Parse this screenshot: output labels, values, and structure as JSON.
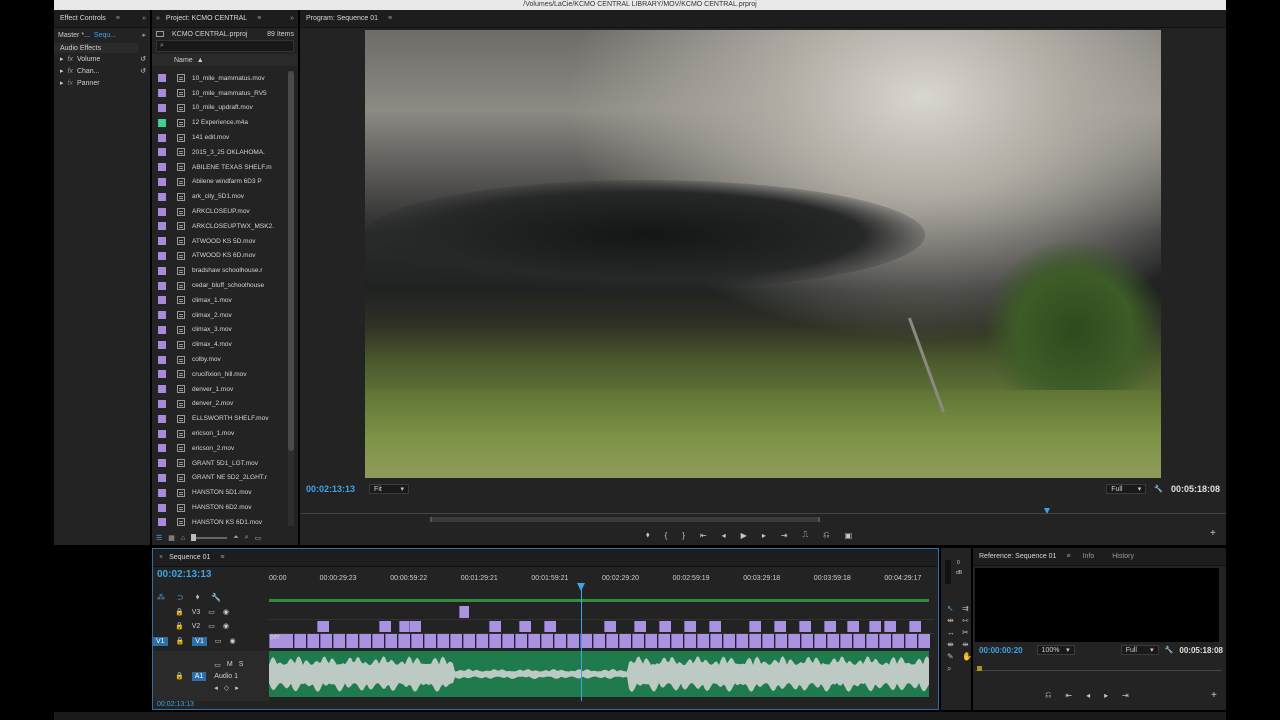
{
  "window": {
    "title": "/Volumes/LaCie/KCMO CENTRAL LIBRARY/MOV/KCMO CENTRAL.prproj"
  },
  "effect_controls": {
    "tab": "Effect Controls",
    "source": "Master *...",
    "sequence": "Sequ...",
    "section": "Audio Effects",
    "items": [
      "Volume",
      "Chan...",
      "Panner"
    ]
  },
  "project": {
    "tab": "Project: KCMO CENTRAL",
    "file": "KCMO CENTRAL.prproj",
    "item_count": "89 Items",
    "column_name": "Name",
    "files": [
      "10_mile_mammatus.mov",
      "10_mile_mammatus_RV5",
      "10_mile_updraft.mov",
      "12 Experience.m4a",
      "141 edit.mov",
      "2015_3_25 OKLAHOMA.",
      "ABILENE TEXAS SHELF.m",
      "Abilene windfarm 6D3 P",
      "ark_city_5D1.mov",
      "ARKCLOSEUP.mov",
      "ARKCLOSEUPTWX_MSK2.",
      "ATWOOD KS 5D.mov",
      "ATWOOD KS 6D.mov",
      "bradshaw schoolhouse.r",
      "cedar_bluff_schoolhouse",
      "climax_1.mov",
      "climax_2.mov",
      "climax_3.mov",
      "climax_4.mov",
      "colby.mov",
      "crucifixion_hill.mov",
      "denver_1.mov",
      "denver_2.mov",
      "ELLSWORTH SHELF.mov",
      "ericson_1.mov",
      "ericson_2.mov",
      "GRANT 5D1_LGT.mov",
      "GRANT NE 5D2_2LGHT.r",
      "HANSTON 5D1.mov",
      "HANSTON 6D2.mov",
      "HANSTON KS 6D1.mov"
    ],
    "audio_swatch_color": "#3fcf8e",
    "video_swatch_color": "#a98ad8"
  },
  "program": {
    "tab": "Program: Sequence 01",
    "timecode": "00:02:13:13",
    "fit": "Fit",
    "quality": "Full",
    "duration": "00:05:18:08"
  },
  "timeline": {
    "tab": "Sequence 01",
    "timecode": "00:02:13:13",
    "ruler": [
      "00:00",
      "00:00:29:23",
      "00:00:59:22",
      "00:01:29:21",
      "00:01:59:21",
      "00:02:29:20",
      "00:02:59:19",
      "00:03:29:18",
      "00:03:59:18",
      "00:04:29:17"
    ],
    "tracks": {
      "v3": "V3",
      "v2": "V2",
      "v1": "V1",
      "v1_src": "V1",
      "a1": "A1",
      "audio1": "Audio 1",
      "m": "M",
      "s": "S"
    },
    "clip_label": "per",
    "bottom_tc": "00:02:13:13",
    "meter_top": "0",
    "meter_db": "dB"
  },
  "reference": {
    "tab": "Reference: Sequence 01",
    "tab_info": "Info",
    "tab_history": "History",
    "timecode": "00:00:00:20",
    "zoom": "100%",
    "quality": "Full",
    "duration": "00:05:18:08"
  }
}
